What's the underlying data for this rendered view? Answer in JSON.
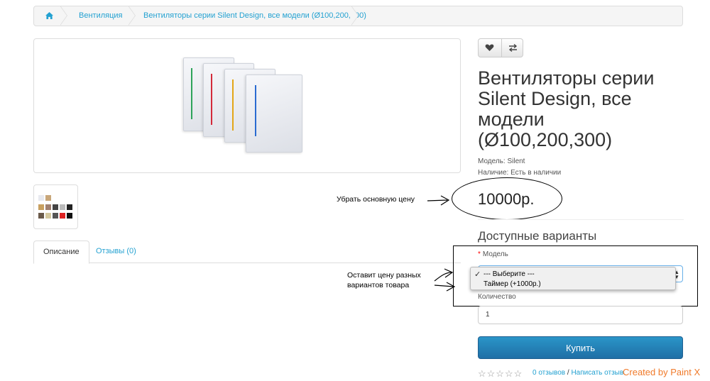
{
  "breadcrumb": {
    "home_icon": "home-icon",
    "items": [
      "Вентиляция",
      "Вентиляторы серии Silent Design, все модели (Ø100,200,300)"
    ]
  },
  "actions": {
    "wishlist_icon": "heart-icon",
    "compare_icon": "compare-icon"
  },
  "product": {
    "title": "Вентиляторы серии Silent Design, все модели (Ø100,200,300)",
    "model_line": "Модель: Silent",
    "availability_line": "Наличие: Есть в наличии",
    "price": "10000р."
  },
  "tabs": [
    "Описание",
    "Отзывы (0)"
  ],
  "options": {
    "title": "Доступные варианты",
    "required_mark": "*",
    "model_label": "Модель",
    "dropdown_items": [
      "--- Выберите ---",
      "Таймер (+1000р.)"
    ],
    "check_mark": "✓",
    "quantity_label": "Количество",
    "quantity_value": "1",
    "buy_label": "Купить"
  },
  "reviews": {
    "stars": "☆☆☆☆☆",
    "count_link": "0 отзывов",
    "separator": " / ",
    "write_link": "Написать отзыв"
  },
  "annotations": {
    "remove_price": "Убрать основную цену",
    "keep_variants_1": "Оставит цену разных",
    "keep_variants_2": "вариантов товара",
    "watermark": "Created by Paint X"
  },
  "colors": {
    "link": "#23a1d1",
    "buy_button": "#2a85bd",
    "watermark": "#f07a2a"
  }
}
